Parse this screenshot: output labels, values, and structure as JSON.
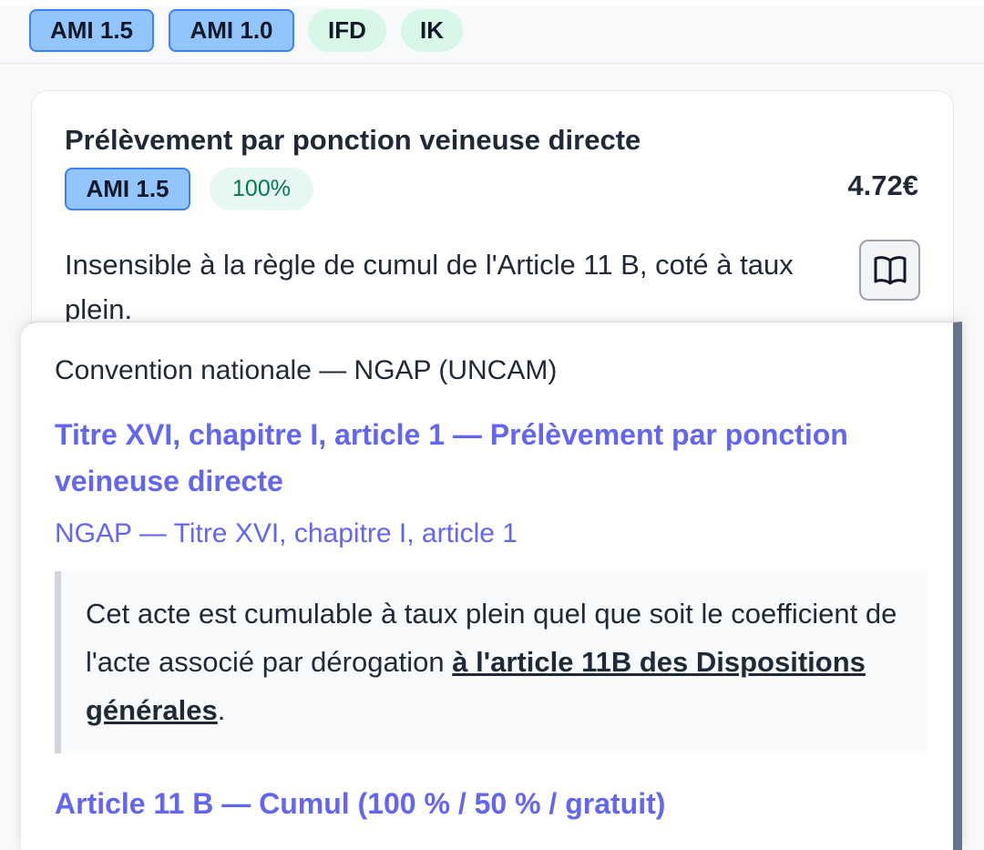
{
  "tabs": [
    {
      "label": "AMI 1.5",
      "style": "blue"
    },
    {
      "label": "AMI 1.0",
      "style": "blue"
    },
    {
      "label": "IFD",
      "style": "green"
    },
    {
      "label": "IK",
      "style": "green"
    }
  ],
  "card": {
    "title": "Prélèvement par ponction veineuse directe",
    "code": "AMI 1.5",
    "rate": "100%",
    "price": "4.72€",
    "description": "Insensible à la règle de cumul de l'Article 11 B, coté à taux plein.",
    "book_icon": "open-book-icon"
  },
  "popover": {
    "source": "Convention nationale — NGAP (UNCAM)",
    "heading": "Titre XVI, chapitre I, article 1 — Prélèvement par ponction veineuse directe",
    "reference": "NGAP — Titre XVI, chapitre I, article 1",
    "quote_before": "Cet acte est cumulable à taux plein quel que soit le coefficient de l'acte associé par dérogation ",
    "quote_link": "à l'article 11B des Dispositions générales",
    "quote_after": ".",
    "article_heading": "Article 11 B — Cumul (100 % / 50 % / gratuit)"
  },
  "colors": {
    "accent": "#6366f1",
    "chip_blue": "#93c5fd",
    "chip_green": "#d9f7e9",
    "rate_text": "#047857"
  }
}
